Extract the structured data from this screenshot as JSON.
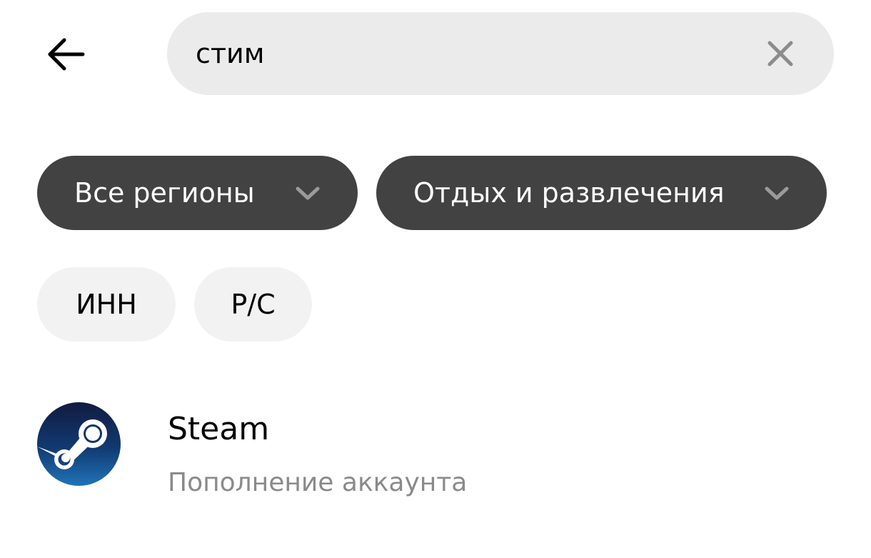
{
  "header": {
    "back_icon": "arrow-left-icon",
    "search": {
      "value": "стим",
      "placeholder": "",
      "clear_icon": "close-icon"
    }
  },
  "filters": {
    "region": {
      "label": "Все регионы",
      "icon": "chevron-down-icon"
    },
    "category": {
      "label": "Отдых и развлечения",
      "icon": "chevron-down-icon"
    },
    "chips": [
      {
        "label": "ИНН"
      },
      {
        "label": "Р/С"
      }
    ]
  },
  "results": [
    {
      "title": "Steam",
      "subtitle": "Пополнение аккаунта",
      "logo": "steam-logo"
    }
  ],
  "colors": {
    "search_bg": "#ebebeb",
    "dropdown_bg": "#424242",
    "chip_bg": "#f2f2f2",
    "subtitle_text": "#8a8a8a",
    "steam_dark": "#0f1a3d",
    "steam_light": "#1f6fb0"
  }
}
